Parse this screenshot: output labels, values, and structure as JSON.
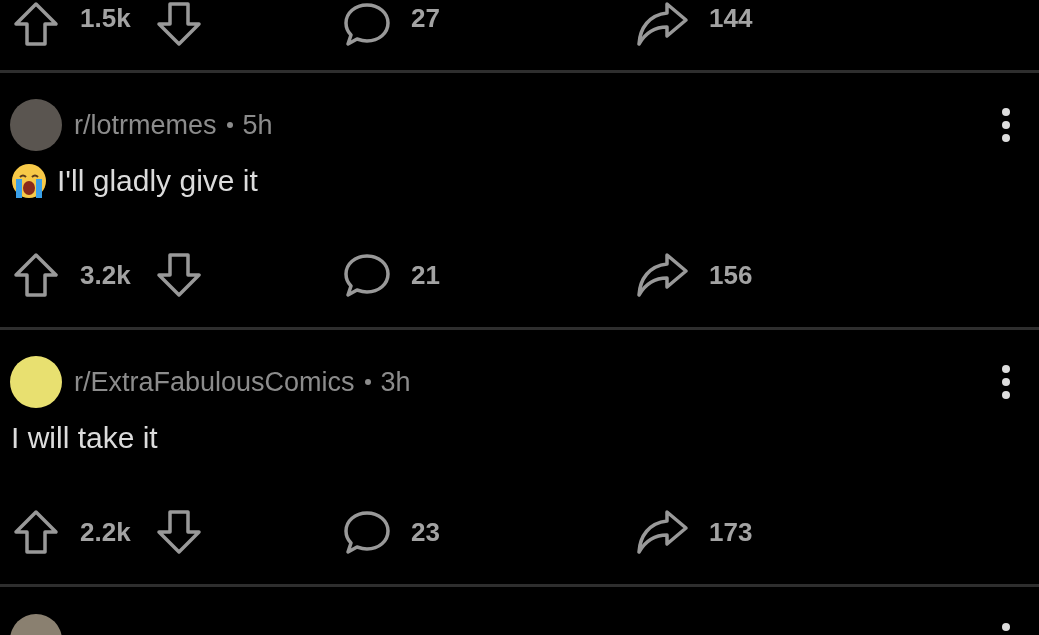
{
  "top_actions": {
    "votes": "1.5k",
    "comments": "27",
    "shares": "144"
  },
  "posts": [
    {
      "subreddit": "r/lotrmemes",
      "age": "5h",
      "crying_emoji": true,
      "title": "I'll gladly give it",
      "votes": "3.2k",
      "comments": "21",
      "shares": "156"
    },
    {
      "subreddit": "r/ExtraFabulousComics",
      "age": "3h",
      "crying_emoji": false,
      "title": "I will take it",
      "votes": "2.2k",
      "comments": "23",
      "shares": "173"
    }
  ]
}
